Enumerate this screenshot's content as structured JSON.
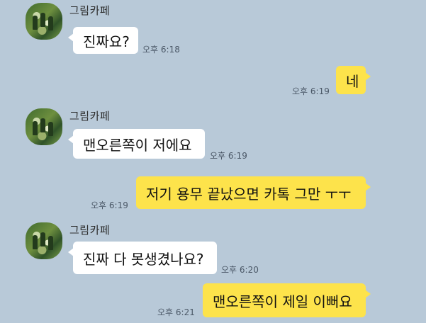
{
  "colors": {
    "background": "#b8c9d8",
    "incoming_bubble": "#ffffff",
    "outgoing_bubble": "#fde34b"
  },
  "messages": [
    {
      "direction": "in",
      "sender": "그림카페",
      "text": "진짜요?",
      "time": "오후 6:18"
    },
    {
      "direction": "out",
      "text": "네",
      "time": "오후 6:19"
    },
    {
      "direction": "in",
      "sender": "그림카페",
      "text": "맨오른쪽이 저에요",
      "time": "오후 6:19"
    },
    {
      "direction": "out",
      "text": "저기 용무 끝났으면 카톡 그만 ㅜㅜ",
      "time": "오후 6:19"
    },
    {
      "direction": "in",
      "sender": "그림카페",
      "text": "진짜 다 못생겼나요?",
      "time": "오후 6:20"
    },
    {
      "direction": "out",
      "text": "맨오른쪽이 제일 이뻐요",
      "time": "오후 6:21"
    }
  ]
}
